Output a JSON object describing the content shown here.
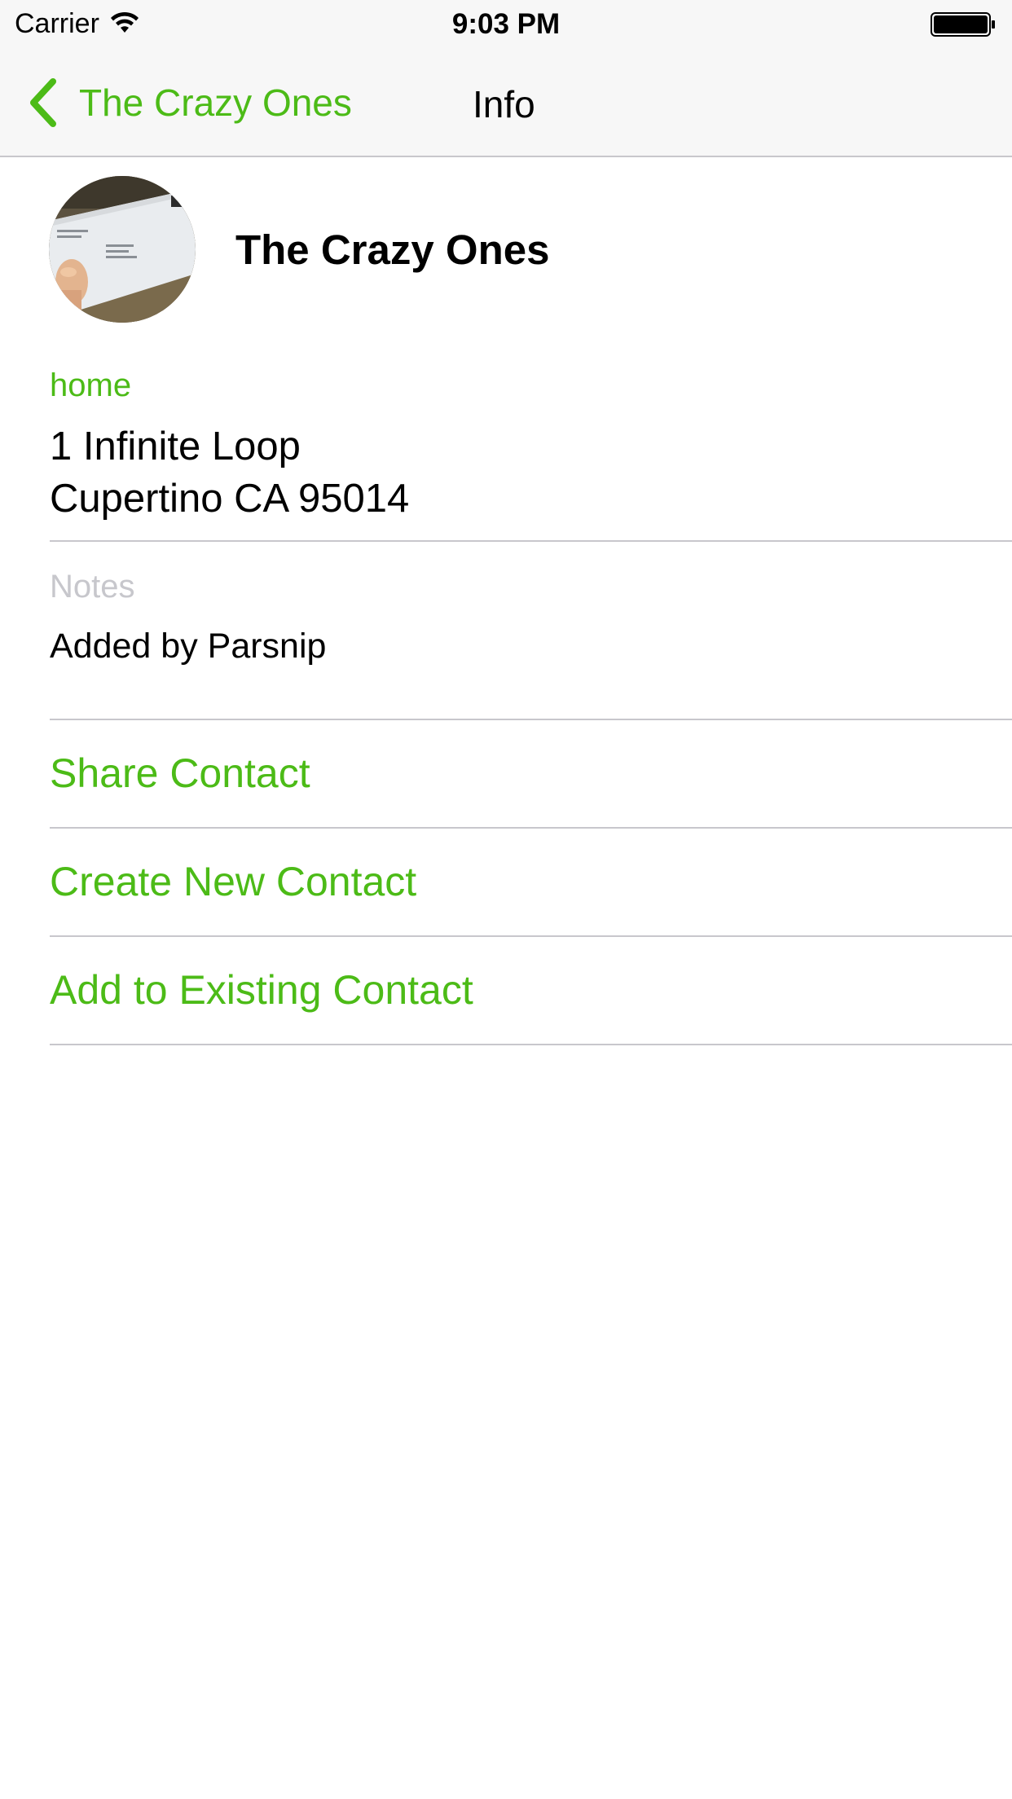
{
  "status_bar": {
    "carrier": "Carrier",
    "time": "9:03 PM",
    "wifi_icon": "wifi-icon",
    "battery_icon": "battery-full-icon"
  },
  "nav": {
    "back_label": "The Crazy Ones",
    "back_icon": "chevron-left-icon",
    "title": "Info"
  },
  "contact": {
    "name": "The Crazy Ones",
    "avatar": "envelope-photo",
    "address": {
      "label": "home",
      "line1": "1 Infinite Loop",
      "line2": "Cupertino CA 95014"
    },
    "notes": {
      "label": "Notes",
      "value": "Added by Parsnip"
    }
  },
  "actions": {
    "share": "Share Contact",
    "create": "Create New Contact",
    "add_existing": "Add to Existing Contact"
  },
  "colors": {
    "accent": "#4cbb17",
    "separator": "#c8c7cc",
    "bar_background": "#f7f7f7",
    "placeholder": "#c7c7cc"
  }
}
